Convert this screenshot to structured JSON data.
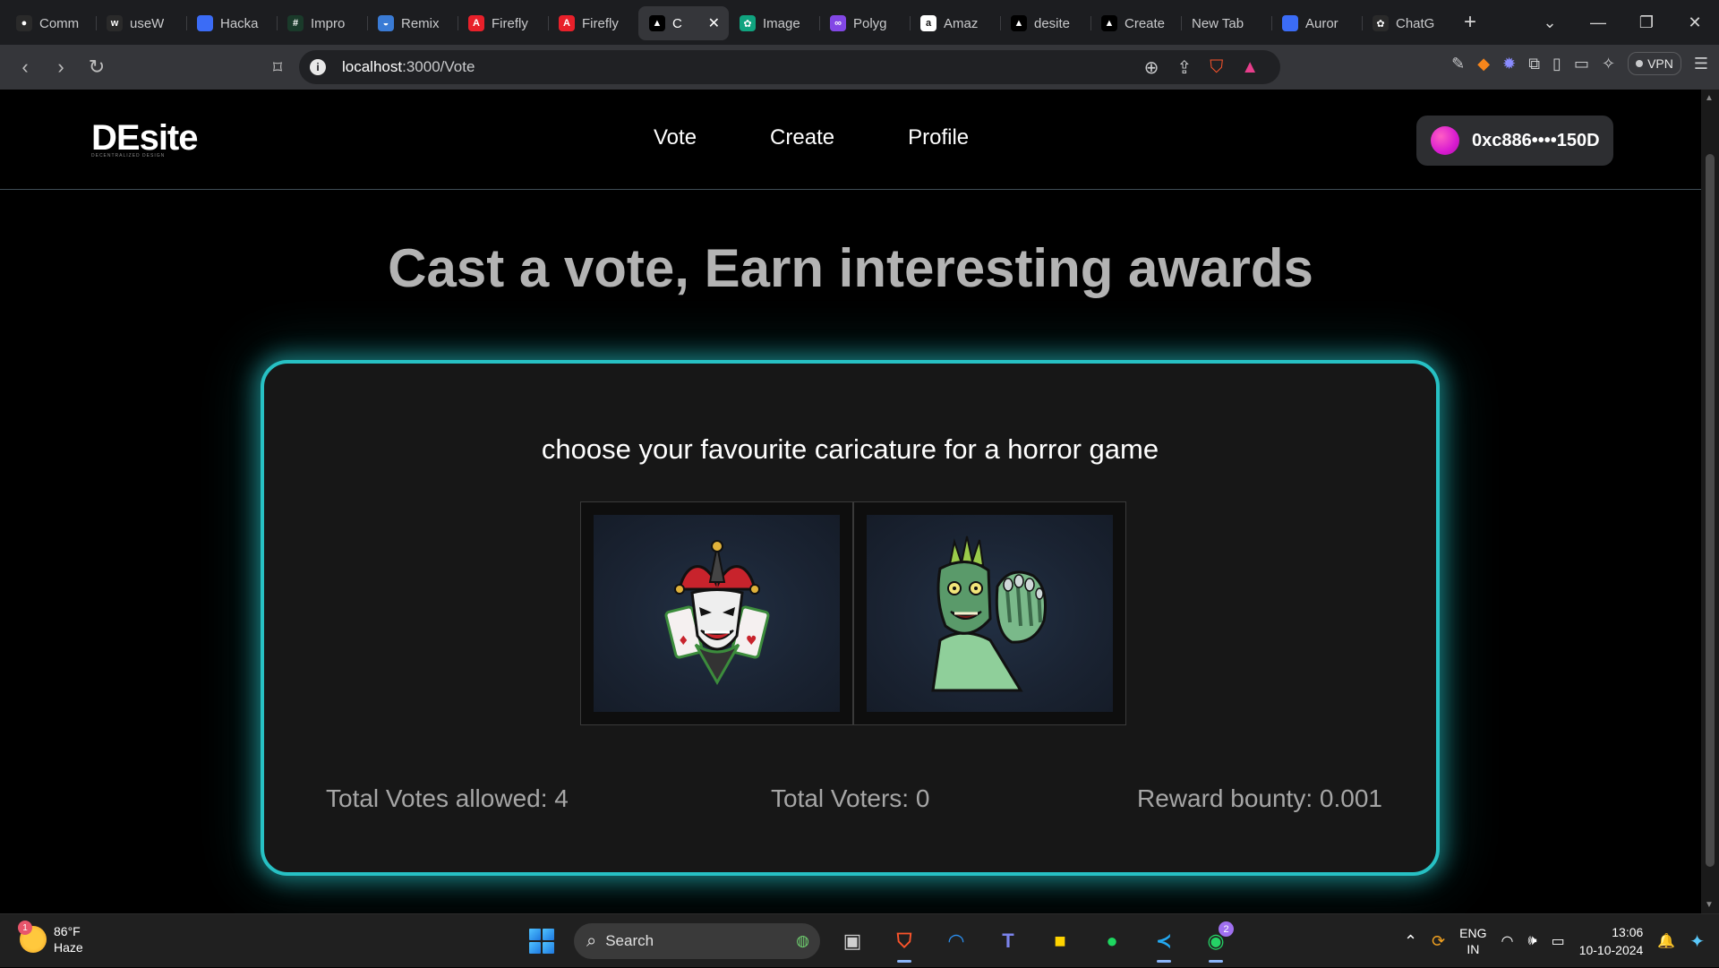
{
  "browser": {
    "tabs": [
      {
        "label": "Comm",
        "fav_color": "#2a2a2a",
        "fav_glyph": "●",
        "active": false
      },
      {
        "label": "useW",
        "fav_color": "#2a2a2a",
        "fav_glyph": "w",
        "active": false
      },
      {
        "label": "Hacka",
        "fav_color": "#3b6cf6",
        "fav_glyph": "",
        "active": false
      },
      {
        "label": "Impro",
        "fav_color": "#1a3a2a",
        "fav_glyph": "#",
        "active": false
      },
      {
        "label": "Remix",
        "fav_color": "#3a7bd5",
        "fav_glyph": "◒",
        "active": false
      },
      {
        "label": "Firefly",
        "fav_color": "#e8202a",
        "fav_glyph": "A",
        "active": false
      },
      {
        "label": "Firefly",
        "fav_color": "#e8202a",
        "fav_glyph": "A",
        "active": false
      },
      {
        "label": "C",
        "fav_color": "#000000",
        "fav_glyph": "▲",
        "active": true
      },
      {
        "label": "Image",
        "fav_color": "#10a37f",
        "fav_glyph": "✿",
        "active": false
      },
      {
        "label": "Polyg",
        "fav_color": "#8247e5",
        "fav_glyph": "∞",
        "active": false
      },
      {
        "label": "Amaz",
        "fav_color": "#ffffff",
        "fav_glyph": "a",
        "active": false
      },
      {
        "label": "desite",
        "fav_color": "#000000",
        "fav_glyph": "▲",
        "active": false
      },
      {
        "label": "Create",
        "fav_color": "#000000",
        "fav_glyph": "▲",
        "active": false
      },
      {
        "label": "New Tab",
        "fav_color": "",
        "fav_glyph": "",
        "active": false
      },
      {
        "label": "Auror",
        "fav_color": "#3b6cf6",
        "fav_glyph": "",
        "active": false
      },
      {
        "label": "ChatG",
        "fav_color": "#2a2a2a",
        "fav_glyph": "✿",
        "active": false
      }
    ],
    "url_host": "localhost",
    "url_path": ":3000/Vote",
    "vpn_label": "VPN"
  },
  "site": {
    "logo": "DEsite",
    "logo_tagline": "DECENTRALIZED DESIGN",
    "nav": [
      "Vote",
      "Create",
      "Profile"
    ],
    "wallet": "0xc886••••150D"
  },
  "main": {
    "headline": "Cast a vote, Earn interesting awards",
    "question": "choose your favourite caricature for a horror game",
    "options": [
      {
        "name": "joker-caricature"
      },
      {
        "name": "zombie-caricature"
      }
    ],
    "stats": {
      "votes_allowed": "Total Votes allowed: 4",
      "voters": "Total Voters: 0",
      "bounty": "Reward bounty: 0.001"
    }
  },
  "taskbar": {
    "weather_temp": "86°F",
    "weather_desc": "Haze",
    "weather_badge": "1",
    "search_label": "Search",
    "whatsapp_badge": "2",
    "lang_top": "ENG",
    "lang_bottom": "IN",
    "time": "13:06",
    "date": "10-10-2024"
  },
  "colors": {
    "accent_glow": "#27c1c4",
    "card_bg": "#171717",
    "headline": "#b3b3b3"
  }
}
